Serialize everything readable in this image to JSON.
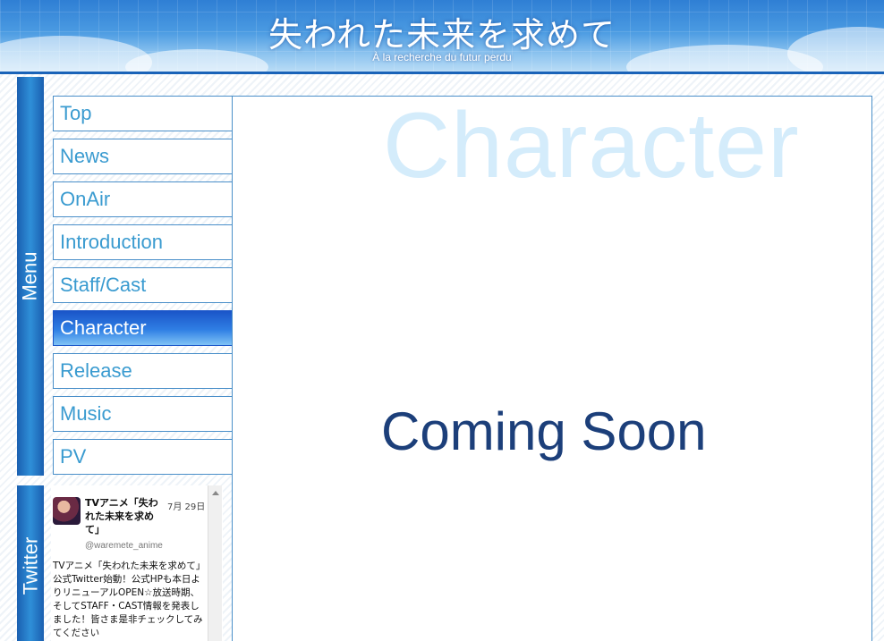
{
  "header": {
    "title": "失われた未来を求めて",
    "subtitle": "À la recherche du futur perdu"
  },
  "menu": {
    "label": "Menu",
    "items": [
      {
        "label": "Top",
        "active": false
      },
      {
        "label": "News",
        "active": false
      },
      {
        "label": "OnAir",
        "active": false
      },
      {
        "label": "Introduction",
        "active": false
      },
      {
        "label": "Staff/Cast",
        "active": false
      },
      {
        "label": "Character",
        "active": true
      },
      {
        "label": "Release",
        "active": false
      },
      {
        "label": "Music",
        "active": false
      },
      {
        "label": "PV",
        "active": false
      }
    ]
  },
  "twitter": {
    "label": "Twitter",
    "tweet": {
      "name": "TVアニメ「失われた未来を求めて」",
      "date": "7月 29日",
      "handle": "@waremete_anime",
      "text": "TVアニメ「失われた未来を求めて」公式Twitter始動！公式HPも本日よりリニューアルOPEN☆放送時期、そしてSTAFF・CAST情報を発表しました！皆さま是非チェックしてみてください"
    }
  },
  "main": {
    "section_title": "Character",
    "message": "Coming Soon"
  },
  "colors": {
    "accent": "#1a63b8",
    "nav_text": "#3a9bd0",
    "active_bg": "#2f7fe4",
    "coming_soon": "#1c3f7a",
    "section_title": "#d4ecfb"
  }
}
